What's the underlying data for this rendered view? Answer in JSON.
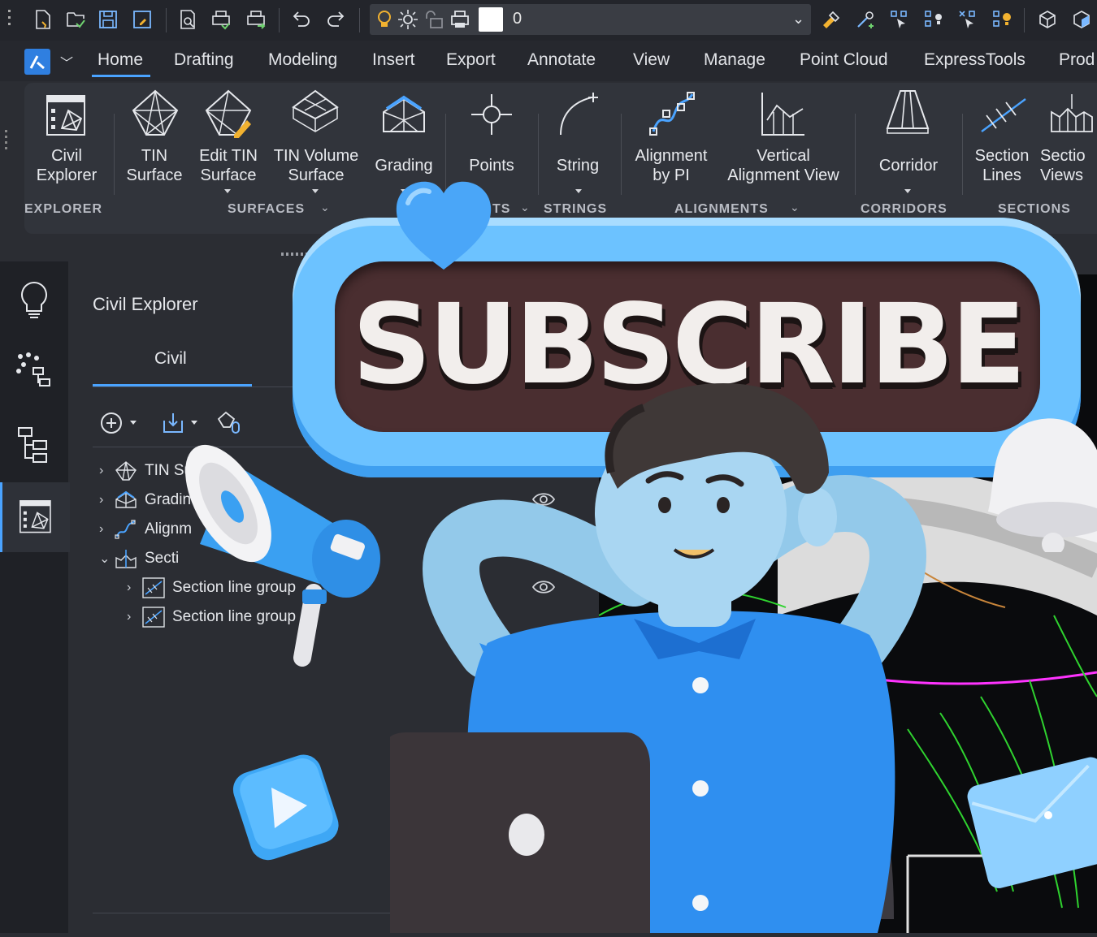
{
  "quick_access": {
    "layer_value": "0",
    "icons": [
      "new-file-icon",
      "open-file-icon",
      "save-icon",
      "save-as-icon",
      "print-preview-icon",
      "plot-icon",
      "publish-icon",
      "undo-icon",
      "redo-icon",
      "layer-bulb-icon",
      "layer-sun-icon",
      "layer-lock-icon",
      "layer-print-icon",
      "layer-color-swatch",
      "combo-chevron-icon",
      "match-properties-icon",
      "pick-select-icon",
      "select-similar-icon",
      "select-icons"
    ]
  },
  "menu": {
    "tabs": [
      "Home",
      "Drafting",
      "Modeling",
      "Insert",
      "Export",
      "Annotate",
      "View",
      "Manage",
      "Point Cloud",
      "ExpressTools",
      "Prod"
    ],
    "active": "Home"
  },
  "ribbon": {
    "buttons": {
      "civil_explorer": [
        "Civil",
        "Explorer"
      ],
      "tin_surface": [
        "TIN",
        "Surface"
      ],
      "edit_tin": [
        "Edit TIN",
        "Surface"
      ],
      "tin_volume": [
        "TIN Volume",
        "Surface"
      ],
      "grading": "Grading",
      "points": "Points",
      "string": "String",
      "alignment_pi": [
        "Alignment",
        "by PI"
      ],
      "vertical_alignment": [
        "Vertical",
        "Alignment View"
      ],
      "corridor": "Corridor",
      "section_lines": [
        "Section",
        "Lines"
      ],
      "section_views": [
        "Sectio",
        "Views"
      ]
    },
    "groups": {
      "explorer": "EXPLORER",
      "surfaces": "SURFACES",
      "points": "TS",
      "strings": "STRINGS",
      "alignments": "ALIGNMENTS",
      "corridors": "CORRIDORS",
      "sections": "SECTIONS"
    }
  },
  "panel": {
    "title": "Civil Explorer",
    "tab": "Civil",
    "tree": [
      {
        "label": "TIN Surfa",
        "expanded": false,
        "level": 0
      },
      {
        "label": "Gradin",
        "expanded": false,
        "level": 0
      },
      {
        "label": "Alignm",
        "expanded": false,
        "level": 0
      },
      {
        "label": "Secti",
        "expanded": true,
        "level": 0
      },
      {
        "label": "Section line group",
        "expanded": false,
        "level": 1
      },
      {
        "label": "Section line group",
        "expanded": false,
        "level": 1
      }
    ]
  },
  "overlay": {
    "subscribe_text": "SUBSCRIBE"
  },
  "colors": {
    "accent": "#4aa3ff",
    "subscribe_frame": "#6cc2ff",
    "subscribe_inner": "#4a2e30",
    "shirt": "#2f8ff0",
    "skin": "#a9d6f2"
  }
}
